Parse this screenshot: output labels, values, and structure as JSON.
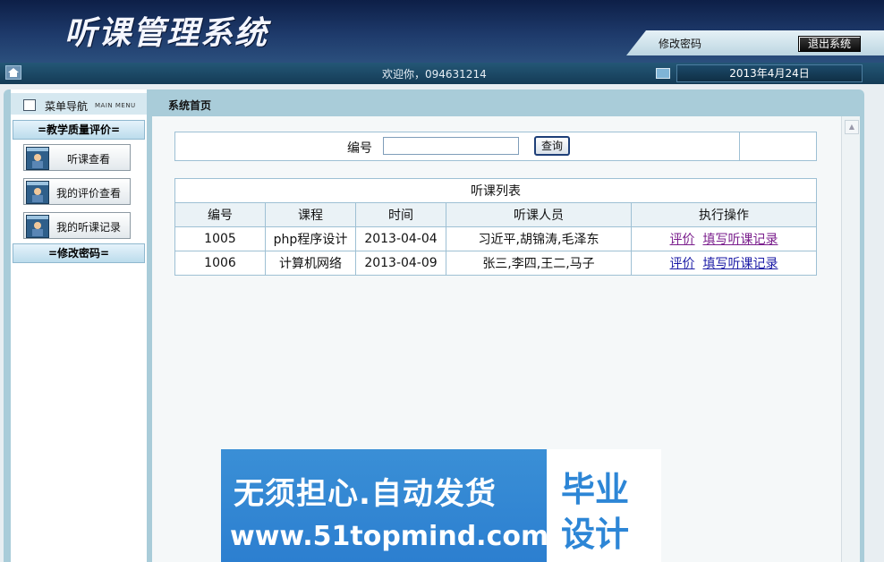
{
  "header": {
    "system_title": "听课管理系统",
    "change_password": "修改密码",
    "logout": "退出系统"
  },
  "statusbar": {
    "welcome": "欢迎你，094631214",
    "date": "2013年4月24日"
  },
  "sidebar": {
    "menu_title": "菜单导航",
    "menu_title_en": "MAIN MENU",
    "section_quality": "=教学质量评价=",
    "items": [
      {
        "label": "听课查看"
      },
      {
        "label": "我的评价查看"
      },
      {
        "label": "我的听课记录"
      }
    ],
    "section_password": "=修改密码="
  },
  "content": {
    "page_title": "系统首页",
    "search": {
      "label": "编号",
      "value": "",
      "button": "查询"
    },
    "list": {
      "caption": "听课列表",
      "columns": [
        "编号",
        "课程",
        "时间",
        "听课人员",
        "执行操作"
      ],
      "rows": [
        {
          "id": "1005",
          "course": "php程序设计",
          "date": "2013-04-04",
          "people": "习近平,胡锦涛,毛泽东",
          "op_evaluate": "评价",
          "op_record": "填写听课记录"
        },
        {
          "id": "1006",
          "course": "计算机网络",
          "date": "2013-04-09",
          "people": "张三,李四,王二,马子",
          "op_evaluate": "评价",
          "op_record": "填写听课记录"
        }
      ]
    }
  },
  "ad": {
    "line1": "无须担心.自动发货",
    "line2": "www.51topmind.com",
    "right_top": "毕业",
    "right_bottom": "设计"
  },
  "colors": {
    "banner": "#1e3a6b",
    "frame": "#a9ccd9",
    "link": "#1a1aa6",
    "ad_blue": "#2c7fd0"
  }
}
